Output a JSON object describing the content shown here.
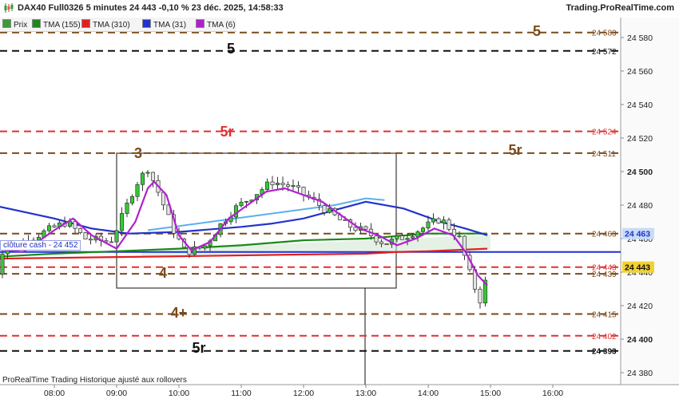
{
  "header": {
    "title": "DAX40 Full0326 5 minutes 24 443 -0,10 % 23 déc. 2025, 14:58:33",
    "brand": "Trading.ProRealTime.com"
  },
  "legend": [
    {
      "label": "Prix",
      "color": "#3a9a3a",
      "icon": "candle-icon"
    },
    {
      "label": "TMA (155)",
      "color": "#1a8a1a"
    },
    {
      "label": "TMA (310)",
      "color": "#e02020"
    },
    {
      "label": "TMA (31)",
      "color": "#2233cc"
    },
    {
      "label": "TMA (6)",
      "color": "#b020d0"
    }
  ],
  "cash_label": "clôture cash -  24 452",
  "footer": "ProRealTime Trading  Historique ajusté aux rollovers",
  "axis": {
    "y_ticks": [
      "24 580",
      "24 560",
      "24 540",
      "24 520",
      "24 500",
      "24 480",
      "24 460",
      "24 440",
      "24 420",
      "24 400",
      "24 380"
    ],
    "x_ticks": [
      "08:00",
      "09:00",
      "10:00",
      "11:00",
      "12:00",
      "13:00",
      "14:00",
      "15:00",
      "16:00"
    ]
  },
  "levels": [
    {
      "text": "5",
      "value": 24583,
      "color": "#7a4a1a",
      "value_text": "24 583",
      "badge_bold": false
    },
    {
      "text": "5",
      "value": 24572,
      "color": "#111111",
      "value_text": "24 572",
      "badge_bold": false
    },
    {
      "text": "5r",
      "value": 24524,
      "color": "#e03030",
      "value_text": "24 524",
      "badge_bold": false
    },
    {
      "text": "5r",
      "value": 24511,
      "color": "#7a4a1a",
      "value_text": "24 511",
      "badge_bold": false
    },
    {
      "text": "",
      "value": 24463,
      "color": "#7a4a1a",
      "value_text": "24 463",
      "badge_bold": false
    },
    {
      "text": "",
      "value": 24443,
      "color": "#e03030",
      "value_text": "24 443",
      "badge_bold": false
    },
    {
      "text": "4",
      "value": 24439,
      "color": "#7a4a1a",
      "value_text": "24 439",
      "badge_bold": false
    },
    {
      "text": "4+",
      "value": 24415,
      "color": "#7a4a1a",
      "value_text": "24 415",
      "badge_bold": false
    },
    {
      "text": "",
      "value": 24402,
      "color": "#e03030",
      "value_text": "24 402",
      "badge_bold": false
    },
    {
      "text": "5r",
      "value": 24393,
      "color": "#111111",
      "value_text": "24 393",
      "badge_bold": true
    }
  ],
  "zone_labels": [
    {
      "text": "3",
      "color": "#7a4a1a"
    }
  ],
  "badges": {
    "tma155": "24 463",
    "price": "24 443"
  },
  "colors": {
    "up": "#33cc33",
    "down": "#e3e3e3",
    "blue_line": "#1f2fd8"
  },
  "chart_data": {
    "type": "line",
    "title": "",
    "ylim": [
      24373,
      24591
    ],
    "x_ticks": [
      "08:00",
      "09:00",
      "10:00",
      "11:00",
      "12:00",
      "13:00",
      "14:00",
      "15:00",
      "16:00"
    ],
    "series": [
      {
        "name": "TMA (155)",
        "values": [
          24452,
          24453,
          24455,
          24457,
          24460,
          24462,
          24463,
          24463,
          24463
        ]
      },
      {
        "name": "TMA (310)",
        "values": [
          24449,
          24449,
          24450,
          24450,
          24451,
          24451,
          24452,
          24453,
          24454
        ]
      },
      {
        "name": "TMA (31)",
        "values": [
          24478,
          24472,
          24462,
          24473,
          24476,
          24484,
          24471,
          24463,
          24460
        ]
      },
      {
        "name": "TMA (6)",
        "values": [
          24456,
          24462,
          24490,
          24478,
          24490,
          24472,
          24465,
          24440,
          24432
        ]
      }
    ],
    "cash_close": 24452
  }
}
